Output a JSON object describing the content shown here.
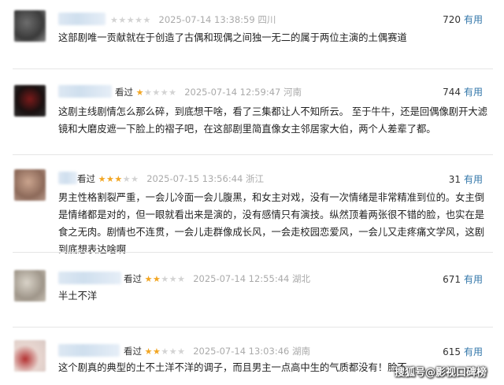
{
  "reviews": [
    {
      "rated_text": "",
      "stars": 0,
      "timestamp": "2025-07-14 13:38:59",
      "location": "四川",
      "votes": "720",
      "useful_label": "有用",
      "content": "这部剧唯一贡献就在于创造了古偶和现偶之间独一无二的属于两位主演的土偶赛道"
    },
    {
      "rated_text": "看过",
      "stars": 1,
      "timestamp": "2025-07-14 12:59:47",
      "location": "河南",
      "votes": "744",
      "useful_label": "有用",
      "content": "这剧主线剧情怎么那么碎，到底想干啥，看了三集都让人不知所云。 至于牛牛，还是回偶像剧开大滤镜和大磨皮遮一下脸上的褶子吧，在这部剧里简直像女主邻居家大伯，两个人差辈了都。"
    },
    {
      "rated_text": "看过",
      "stars": 3,
      "timestamp": "2025-07-15 13:56:44",
      "location": "浙江",
      "votes": "31",
      "useful_label": "有用",
      "content": "男主性格割裂严重，一会儿冷面一会儿腹黑，和女主对戏，没有一次情绪是非常精准到位的。女主倒是情绪都是对的，但一眼就看出来是演的，没有感情只有演技。纵然顶着两张很不错的脸，也实在是食之无肉。剧情也不连贯，一会儿走群像成长风，一会走校园恋爱风，一会儿又走疼痛文学风，这剧到底想表达啥啊"
    },
    {
      "rated_text": "看过",
      "stars": 2,
      "timestamp": "2025-07-14 12:55:44",
      "location": "湖北",
      "votes": "671",
      "useful_label": "有用",
      "content": "半土不洋"
    },
    {
      "rated_text": "看过",
      "stars": 2,
      "timestamp": "2025-07-14 13:03:46",
      "location": "湖南",
      "votes": "615",
      "useful_label": "有用",
      "content": "这个剧真的典型的土不土洋不洋的调子，而且男主一点高中生的气质都没有！脸不"
    }
  ],
  "watermark": "搜狐号@影视口碑榜",
  "colors": {
    "useful_link": "#3377aa",
    "star_on": "#f2a623",
    "star_off": "#d3d3d3",
    "meta_gray": "#aaaaaa"
  }
}
